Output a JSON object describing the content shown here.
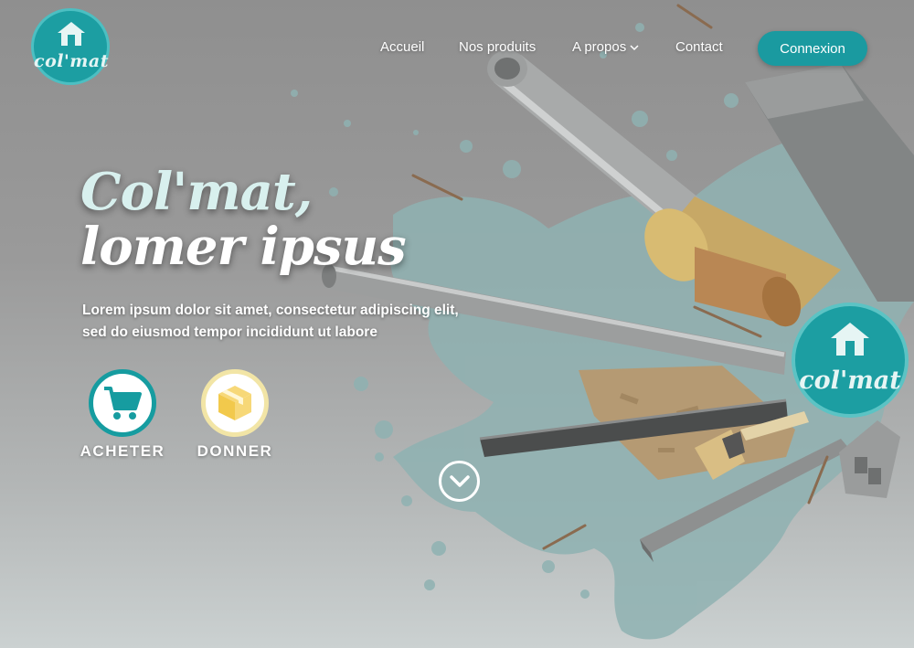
{
  "brand": {
    "logo_text": "col'mat",
    "badge_text": "col'mat"
  },
  "nav": {
    "items": [
      {
        "label": "Accueil"
      },
      {
        "label": "Nos produits"
      },
      {
        "label": "A propos"
      },
      {
        "label": "Contact"
      }
    ],
    "login_label": "Connexion"
  },
  "hero": {
    "title_line1": "Col'mat,",
    "title_line2": "lomer ipsus",
    "subtitle_line1": "Lorem ipsum dolor sit amet, consectetur adipiscing elit,",
    "subtitle_line2": "sed do eiusmod tempor incididunt ut labore",
    "actions": [
      {
        "label": "ACHETER",
        "icon": "shopping-cart-icon"
      },
      {
        "label": "DONNER",
        "icon": "box-icon"
      }
    ],
    "scroll_icon": "chevron-down-circle-icon"
  },
  "colors": {
    "accent": "#1a9aa0",
    "accent_light": "#d8f0ee",
    "donate": "#f7d878"
  }
}
